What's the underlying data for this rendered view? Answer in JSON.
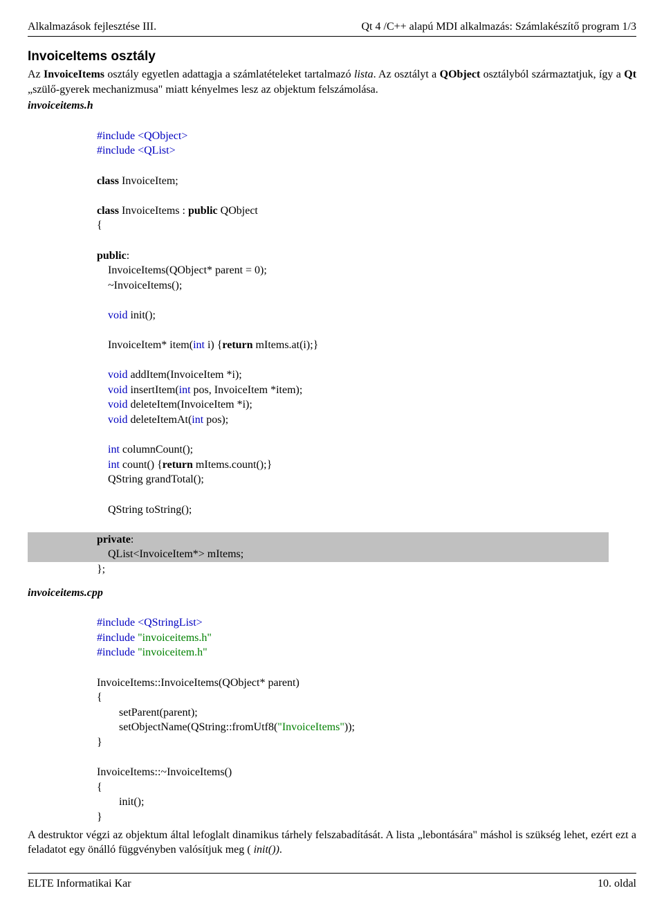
{
  "header": {
    "left": "Alkalmazások fejlesztése III.",
    "right": "Qt 4 /C++ alapú MDI alkalmazás: Számlakészítő program 1/3"
  },
  "section1": {
    "title": "InvoiceItems osztály",
    "p1a": "Az ",
    "p1b": "InvoiceItems",
    "p1c": " osztály egyetlen adattagja a számlatételeket tartalmazó ",
    "p1d": "lista",
    "p1e": ". Az osztályt a ",
    "p1f": "QObject",
    "p1g": " osztályból származtatjuk, így a ",
    "p1h": "Qt",
    "p1i": " „szülő-gyerek mechanizmusa\" miatt kényelmes lesz az objektum felszámolása."
  },
  "file1": "invoiceitems.h",
  "code1": {
    "inc1a": "#include <QObject>",
    "inc1b": "#include <QList>",
    "cls1a": "class",
    "cls1b": " InvoiceItem;",
    "cls2a": "class",
    "cls2b": " InvoiceItems : ",
    "cls2c": "public",
    "cls2d": " QObject",
    "brace_open": "{",
    "pub": "public",
    "pub_colon": ":",
    "ctor1": "    InvoiceItems(QObject* parent = 0);",
    "dtor1": "    ~InvoiceItems();",
    "void_kw": "void",
    "init_sig": " init();",
    "item_ln_a": "    InvoiceItem* item(",
    "int_kw": "int",
    "item_ln_b": " i) {",
    "return_kw": "return",
    "item_ln_c": " mItems.at(i);}",
    "add_a": " addItem(InvoiceItem *i);",
    "ins_a": " insertItem(",
    "ins_b": " pos, InvoiceItem *item);",
    "del_a": " deleteItem(InvoiceItem *i);",
    "delat_a": " deleteItemAt(",
    "delat_b": " pos);",
    "colcnt": " columnCount();",
    "cnt_a": " count() {",
    "cnt_b": " mItems.count();}",
    "gt": "    QString grandTotal();",
    "tostr": "    QString toString();",
    "priv": "private",
    "priv_colon": ":",
    "mitems": "    QList<InvoiceItem*> mItems;",
    "brace_close": "};"
  },
  "file2": "invoiceitems.cpp",
  "code2": {
    "inc2a": "#include <QStringList>",
    "inc2b_a": "#include ",
    "inc2b_b": "\"invoiceitems.h\"",
    "inc2c_a": "#include ",
    "inc2c_b": "\"invoiceitem.h\"",
    "ctor2": "InvoiceItems::InvoiceItems(QObject* parent)",
    "bo": "{",
    "sp": "        setParent(parent);",
    "son_a": "        setObjectName(QString::fromUtf8(",
    "son_b": "\"InvoiceItems\"",
    "son_c": "));",
    "bc": "}",
    "dtor2": "InvoiceItems::~InvoiceItems()",
    "init_call": "        init();"
  },
  "footer_para_a": "A destruktor végzi az objektum által lefoglalt dinamikus tárhely felszabadítását. A lista „lebontására\" máshol is szükség lehet, ezért ezt a feladatot egy önálló függvényben valósítjuk meg (",
  "footer_para_b": " init())",
  "footer_para_c": ".",
  "footer": {
    "left": "ELTE Informatikai Kar",
    "right": "10. oldal"
  }
}
